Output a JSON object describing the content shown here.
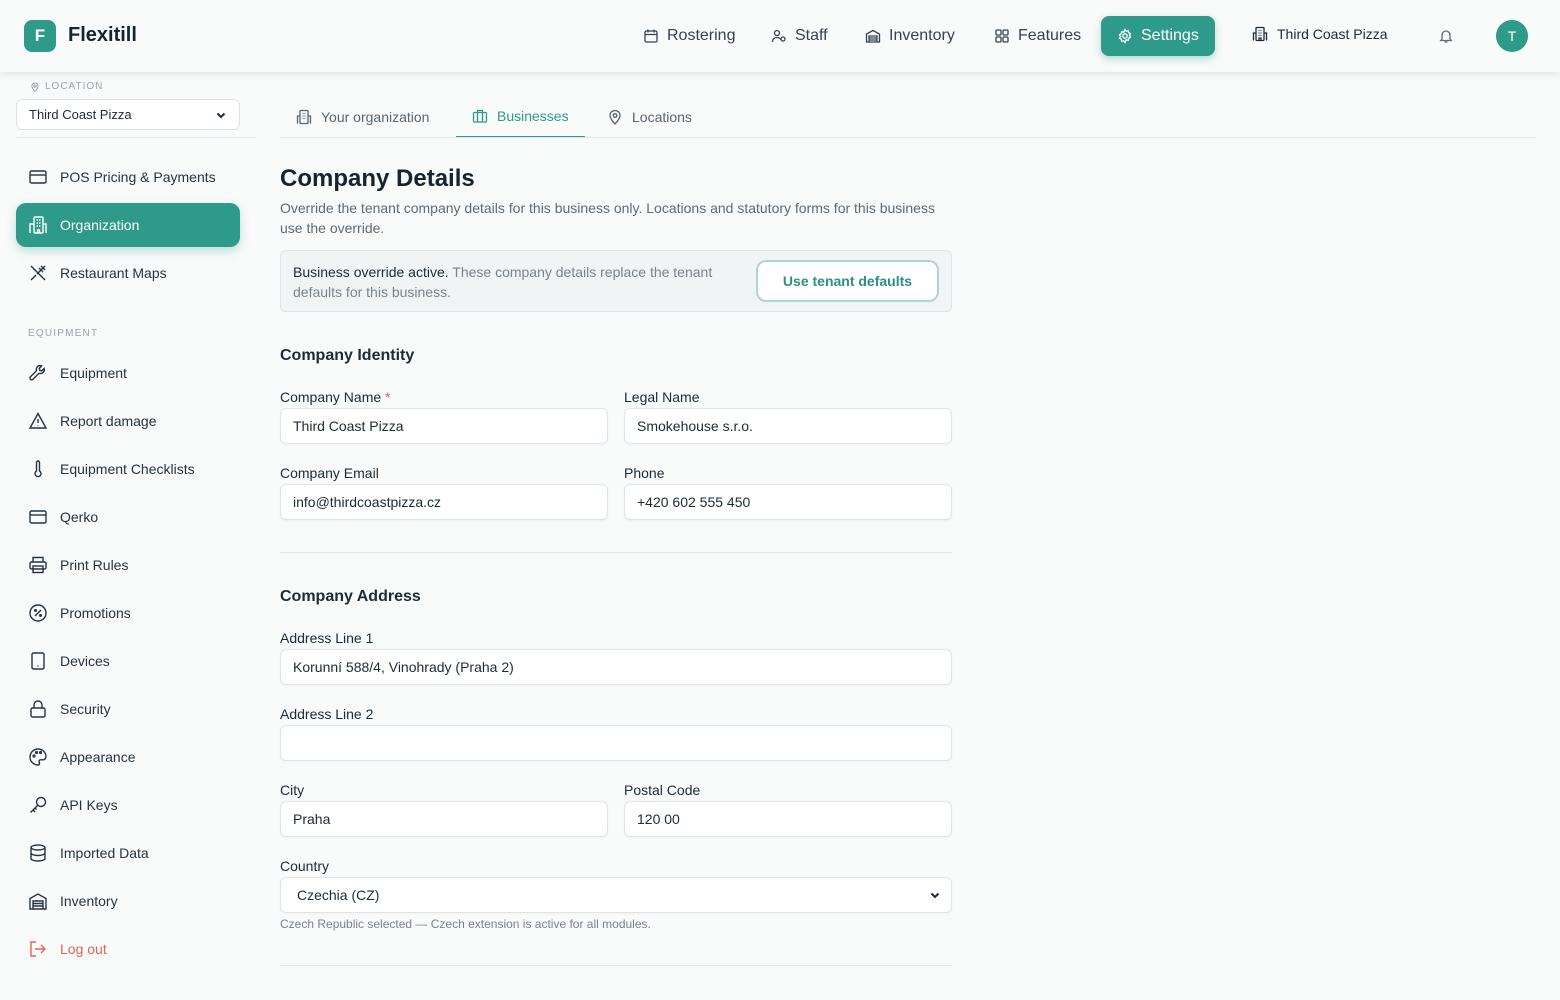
{
  "app": {
    "logo_letter": "F",
    "name": "Flexitill",
    "accent": "#2e9a8a"
  },
  "topnav": {
    "items": [
      {
        "label": "Rostering",
        "icon": "calendar-icon"
      },
      {
        "label": "Staff",
        "icon": "users-icon"
      },
      {
        "label": "Inventory",
        "icon": "warehouse-icon"
      },
      {
        "label": "Features",
        "icon": "grid-icon"
      },
      {
        "label": "Settings",
        "icon": "gear-icon",
        "active": true
      }
    ],
    "business": "Third Coast Pizza",
    "avatar_letter": "T"
  },
  "sidebar": {
    "location_label": "LOCATION",
    "location_value": "Third Coast Pizza",
    "items": [
      {
        "label": "POS Pricing & Payments",
        "icon": "credit-card-icon"
      },
      {
        "label": "Organization",
        "icon": "building-icon",
        "active": true
      },
      {
        "label": "Restaurant Maps",
        "icon": "utensils-icon"
      }
    ],
    "section_label": "EQUIPMENT",
    "equipment": [
      {
        "label": "Equipment",
        "icon": "wrench-icon"
      },
      {
        "label": "Report damage",
        "icon": "warning-icon"
      },
      {
        "label": "Equipment Checklists",
        "icon": "thermometer-icon"
      },
      {
        "label": "Qerko",
        "icon": "card-icon"
      },
      {
        "label": "Print Rules",
        "icon": "printer-icon"
      },
      {
        "label": "Promotions",
        "icon": "discount-icon"
      },
      {
        "label": "Devices",
        "icon": "tablet-icon"
      },
      {
        "label": "Security",
        "icon": "lock-icon"
      },
      {
        "label": "Appearance",
        "icon": "palette-icon"
      },
      {
        "label": "API Keys",
        "icon": "key-icon"
      },
      {
        "label": "Imported Data",
        "icon": "database-icon"
      },
      {
        "label": "Inventory",
        "icon": "warehouse-icon"
      }
    ],
    "logout": "Log out"
  },
  "tabs": [
    {
      "label": "Your organization",
      "icon": "building-icon"
    },
    {
      "label": "Businesses",
      "icon": "briefcase-icon",
      "active": true
    },
    {
      "label": "Locations",
      "icon": "map-pin-icon"
    }
  ],
  "main": {
    "title": "Company Details",
    "description": "Override the tenant company details for this business only. Locations and statutory forms for this business use the override.",
    "notice": {
      "bold": "Business override active.",
      "text": " These company details replace the tenant defaults for this business.",
      "button": "Use tenant defaults"
    },
    "identity": {
      "heading": "Company Identity",
      "company_name_label": "Company Name",
      "required_mark": "*",
      "company_name": "Third Coast Pizza",
      "legal_name_label": "Legal Name",
      "legal_name": "Smokehouse s.r.o.",
      "email_label": "Company Email",
      "email": "info@thirdcoastpizza.cz",
      "phone_label": "Phone",
      "phone": "+420 602 555 450"
    },
    "address": {
      "heading": "Company Address",
      "line1_label": "Address Line 1",
      "line1": "Korunní 588/4, Vinohrady (Praha 2)",
      "line2_label": "Address Line 2",
      "line2": "",
      "city_label": "City",
      "city": "Praha",
      "postal_label": "Postal Code",
      "postal": "120 00",
      "country_label": "Country",
      "country": "Czechia (CZ)",
      "hint": "Czech Republic selected — Czech extension is active for all modules."
    }
  }
}
